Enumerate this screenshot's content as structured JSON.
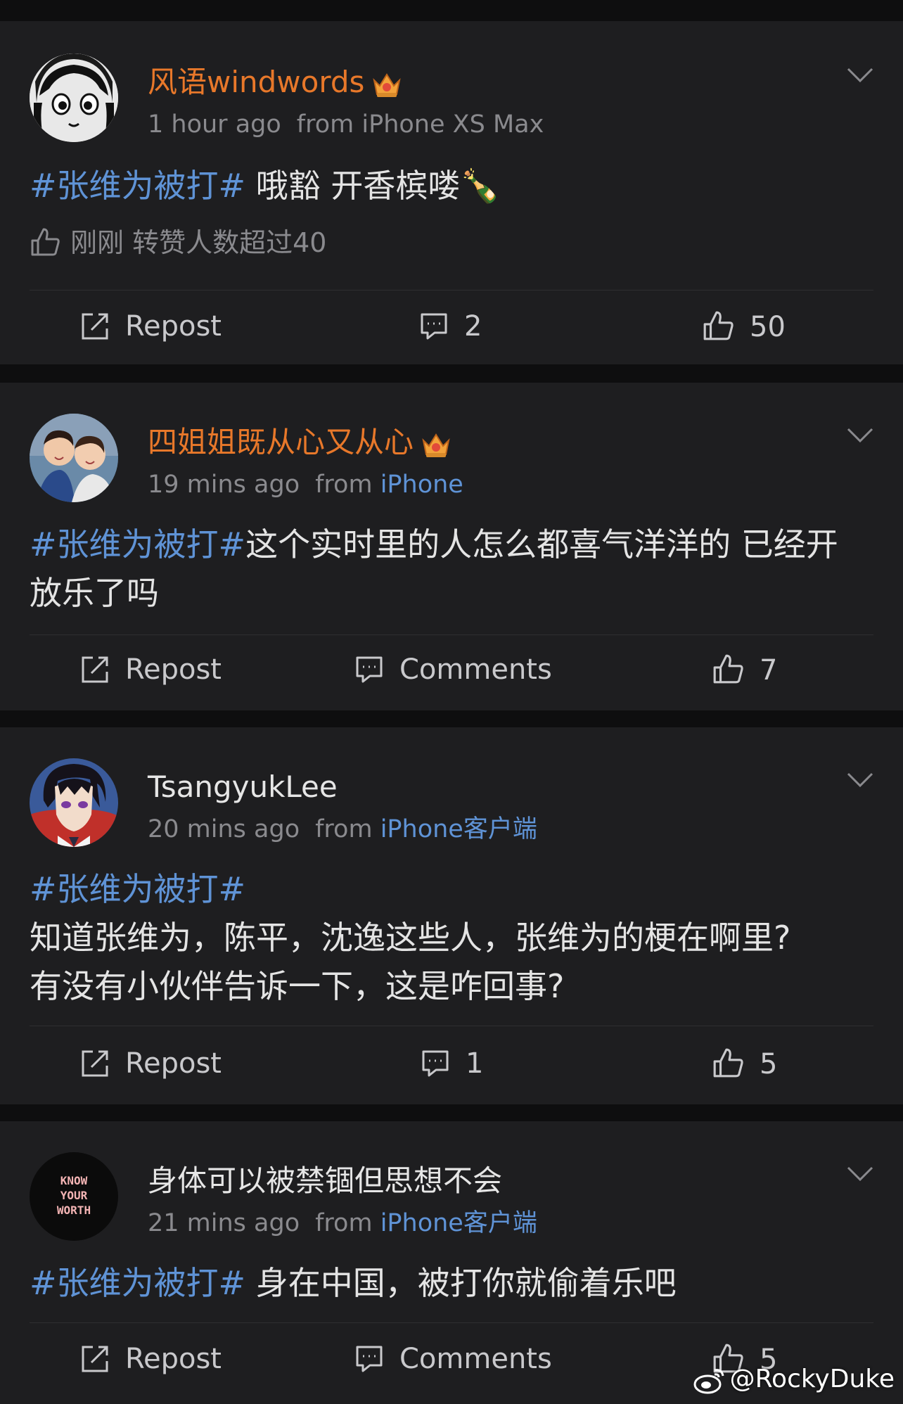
{
  "posts": [
    {
      "username": "风语windwords",
      "vip": true,
      "time": "1 hour ago",
      "from_label": "from",
      "source": "iPhone XS Max",
      "source_highlight": false,
      "hashtag": "#张维为被打#",
      "body_lines": [
        " 哦豁 开香槟喽🍾"
      ],
      "liked_notice": "刚刚 转赞人数超过40",
      "repost_label": "Repost",
      "comments_label": "2",
      "likes": "50"
    },
    {
      "username": "四姐姐既从心又从心",
      "vip": true,
      "time": "19 mins ago",
      "from_label": "from",
      "source": "iPhone",
      "source_highlight": true,
      "hashtag": "#张维为被打#",
      "body_lines": [
        "这个实时里的人怎么都喜气洋洋的 已经开",
        "放乐了吗"
      ],
      "repost_label": "Repost",
      "comments_label": "Comments",
      "likes": "7"
    },
    {
      "username": "TsangyukLee",
      "vip": false,
      "time": "20 mins ago",
      "from_label": "from",
      "source": "iPhone客户端",
      "source_highlight": true,
      "hashtag": "#张维为被打#",
      "body_lines": [
        "知道张维为，陈平，沈逸这些人，张维为的梗在啊里?",
        "有没有小伙伴告诉一下，这是咋回事?"
      ],
      "repost_label": "Repost",
      "comments_label": "1",
      "likes": "5"
    },
    {
      "username": "身体可以被禁锢但思想不会",
      "vip": false,
      "time": "21 mins ago",
      "from_label": "from",
      "source": "iPhone客户端",
      "source_highlight": true,
      "avatar_text": [
        "KNOW",
        "YOUR",
        "WORTH"
      ],
      "hashtag": "#张维为被打#",
      "body_lines": [
        " 身在中国，被打你就偷着乐吧"
      ],
      "repost_label": "Repost",
      "comments_label": "Comments",
      "likes": "5"
    }
  ],
  "watermark": "@RockyDuke",
  "colors": {
    "vip_name": "#e8782a",
    "link": "#5f93d6",
    "card": "#1e1e20",
    "background": "#0e0e0f"
  }
}
